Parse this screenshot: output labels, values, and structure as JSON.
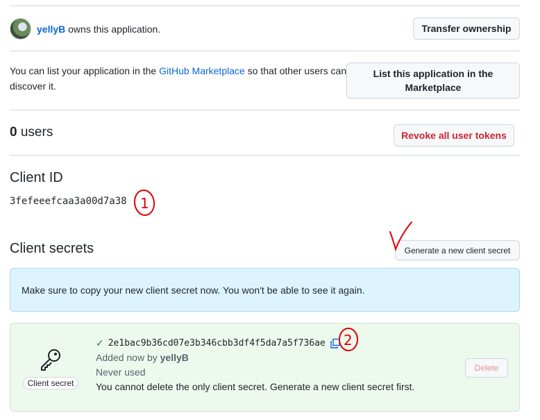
{
  "owner": {
    "username": "yellyB",
    "suffix": "owns this application.",
    "transfer_button": "Transfer ownership"
  },
  "marketplace": {
    "text_before": "You can list your application in the ",
    "link_text": "GitHub Marketplace",
    "text_after": " so that other users can discover it.",
    "button_line1": "List this application in the",
    "button_line2": "Marketplace"
  },
  "users": {
    "count": "0",
    "label": "users",
    "revoke_button": "Revoke all user tokens"
  },
  "client_id": {
    "title": "Client ID",
    "value": "3fefeeefcaa3a00d7a38"
  },
  "client_secrets": {
    "title": "Client secrets",
    "generate_button": "Generate a new client secret",
    "flash_message": "Make sure to copy your new client secret now. You won't be able to see it again.",
    "secret": {
      "value": "2e1bac9b36cd07e3b346cbb3df4f5da7a5f736ae",
      "added_by_prefix": "Added now by ",
      "added_by_user": "yellyB",
      "usage": "Never used",
      "delete_note": "You cannot delete the only client secret. Generate a new client secret first.",
      "badge": "Client secret",
      "delete_button": "Delete"
    }
  },
  "annotations": {
    "mark_1": "1",
    "mark_2": "2",
    "color": "#e00000"
  },
  "colors": {
    "link": "#0969da",
    "danger": "#cf222e",
    "success": "#1a7f37",
    "flash_bg": "#ddf4ff",
    "secret_bg": "#eef9ee"
  }
}
